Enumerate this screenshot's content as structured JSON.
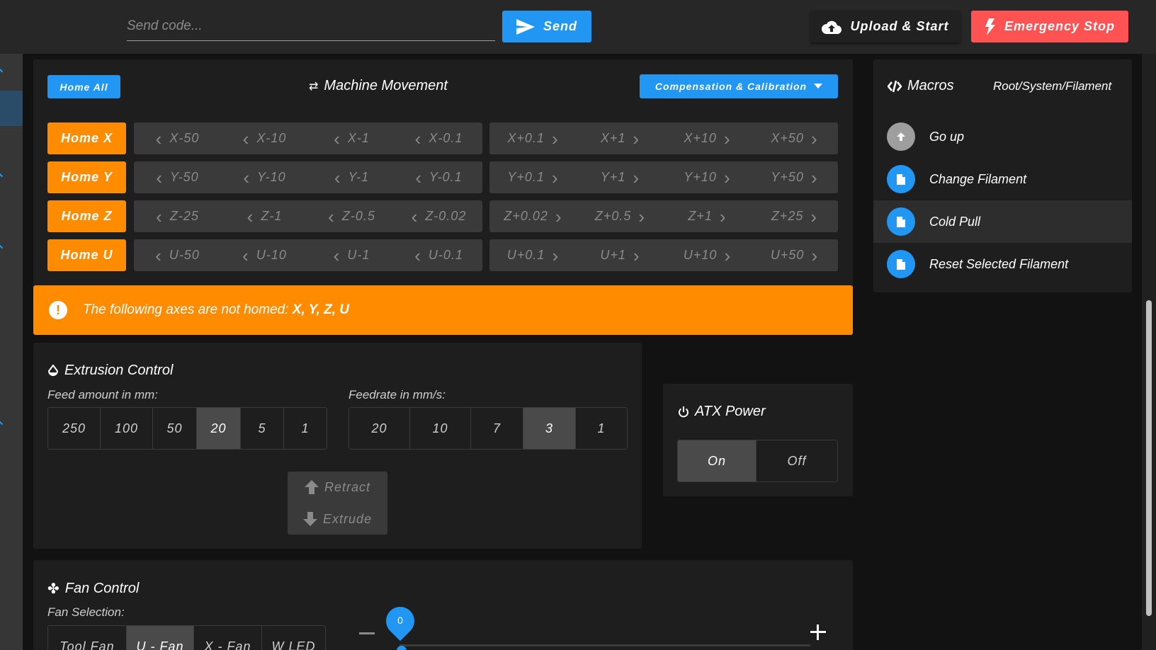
{
  "topbar": {
    "send_placeholder": "Send code...",
    "send_label": "Send",
    "upload_label": "Upload & Start",
    "estop_label": "Emergency Stop"
  },
  "movement": {
    "home_all_label": "Home All",
    "title": "Machine Movement",
    "compensation_label": "Compensation & Calibration",
    "axes": [
      {
        "home_label": "Home X",
        "minus": [
          "X-50",
          "X-10",
          "X-1",
          "X-0.1"
        ],
        "plus": [
          "X+0.1",
          "X+1",
          "X+10",
          "X+50"
        ]
      },
      {
        "home_label": "Home Y",
        "minus": [
          "Y-50",
          "Y-10",
          "Y-1",
          "Y-0.1"
        ],
        "plus": [
          "Y+0.1",
          "Y+1",
          "Y+10",
          "Y+50"
        ]
      },
      {
        "home_label": "Home Z",
        "minus": [
          "Z-25",
          "Z-1",
          "Z-0.5",
          "Z-0.02"
        ],
        "plus": [
          "Z+0.02",
          "Z+0.5",
          "Z+1",
          "Z+25"
        ]
      },
      {
        "home_label": "Home U",
        "minus": [
          "U-50",
          "U-10",
          "U-1",
          "U-0.1"
        ],
        "plus": [
          "U+0.1",
          "U+1",
          "U+10",
          "U+50"
        ]
      }
    ],
    "warning_text": "The following axes are not homed: ",
    "warning_axes": "X, Y, Z, U"
  },
  "macros": {
    "title": "Macros",
    "path": "Root/System/Filament",
    "items": [
      {
        "label": "Go up",
        "icon": "arrow-up-icon"
      },
      {
        "label": "Change Filament",
        "icon": "file-icon"
      },
      {
        "label": "Cold Pull",
        "icon": "file-icon"
      },
      {
        "label": "Reset Selected Filament",
        "icon": "file-icon"
      }
    ]
  },
  "extrusion": {
    "title": "Extrusion Control",
    "feed_label": "Feed amount in mm:",
    "feed_options": [
      "250",
      "100",
      "50",
      "20",
      "5",
      "1"
    ],
    "feed_selected": "20",
    "rate_label": "Feedrate in mm/s:",
    "rate_options": [
      "20",
      "10",
      "7",
      "3",
      "1"
    ],
    "rate_selected": "3",
    "retract_label": "Retract",
    "extrude_label": "Extrude"
  },
  "atx": {
    "title": "ATX Power",
    "on_label": "On",
    "off_label": "Off",
    "selected": "On"
  },
  "fan": {
    "title": "Fan Control",
    "selection_label": "Fan Selection:",
    "fans": [
      "Tool Fan",
      "U - Fan",
      "X - Fan",
      "W LED"
    ],
    "selected_fan": "U - Fan",
    "value": "0"
  },
  "colors": {
    "accent": "#2196f3",
    "warning": "#ff8c00",
    "danger": "#ff5252"
  }
}
